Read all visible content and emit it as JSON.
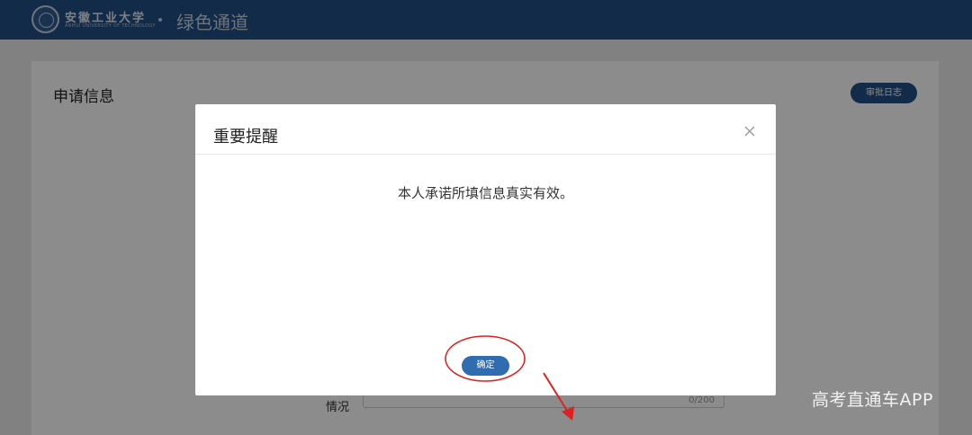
{
  "header": {
    "university_cn": "安徽工业大学",
    "university_en": "ANHUI UNIVERSITY OF TECHNOLOGY",
    "app_title": "绿色通道",
    "logo_icon": "university-seal-icon"
  },
  "page": {
    "section_title": "申请信息",
    "log_button": "审批日志",
    "field_label": "情况",
    "field_counter": "0/200"
  },
  "dialog": {
    "title": "重要提醒",
    "close_icon": "close-icon",
    "message": "本人承诺所填信息真实有效。",
    "confirm_label": "确定"
  },
  "annotations": {
    "highlight_color": "#e02020",
    "watermark": "高考直通车APP"
  },
  "colors": {
    "header_bg": "#1f4f86",
    "primary_button": "#2f6db0"
  }
}
